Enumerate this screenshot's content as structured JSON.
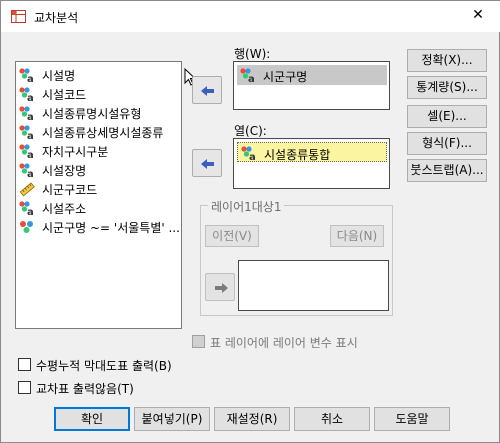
{
  "window": {
    "title": "교차분석",
    "close_glyph": "✕"
  },
  "variables": [
    {
      "label": "시설명",
      "icon": "nominal-string-icon"
    },
    {
      "label": "시설코드",
      "icon": "nominal-string-icon"
    },
    {
      "label": "시설종류명시설유형",
      "icon": "nominal-string-icon"
    },
    {
      "label": "시설종류상세명시설종류",
      "icon": "nominal-string-icon"
    },
    {
      "label": "자치구시구분",
      "icon": "nominal-string-icon"
    },
    {
      "label": "시설장명",
      "icon": "nominal-string-icon"
    },
    {
      "label": "시군구코드",
      "icon": "scale-ruler-icon"
    },
    {
      "label": "시설주소",
      "icon": "nominal-string-icon"
    },
    {
      "label": "시군구명 ~= '서울특별' ...",
      "icon": "nominal-icon"
    }
  ],
  "rows": {
    "label": "행(W):",
    "items": [
      "시군구명"
    ]
  },
  "columns": {
    "label": "열(C):",
    "items": [
      "시설종류통합"
    ]
  },
  "layer": {
    "title": "레이어1대상1",
    "prev_label": "이전(V)",
    "next_label": "다음(N)"
  },
  "layer_checkbox": {
    "label": "표 레이어에 레이어 변수 표시",
    "checked": false,
    "enabled": false
  },
  "right_buttons": [
    "정확(X)...",
    "통계량(S)...",
    "셀(E)...",
    "형식(F)...",
    "붓스트랩(A)..."
  ],
  "options": [
    {
      "label": "수평누적 막대도표 출력(B)",
      "checked": false
    },
    {
      "label": "교차표 출력않음(T)",
      "checked": false
    }
  ],
  "bottom_buttons": [
    "확인",
    "붙여넣기(P)",
    "재설정(R)",
    "취소",
    "도움말"
  ],
  "colors": {
    "accent": "#0078d7",
    "selected_row": "#c8c8c8",
    "selected_col": "#fbf4a0",
    "arrow_blue": "#3a5fbf"
  }
}
